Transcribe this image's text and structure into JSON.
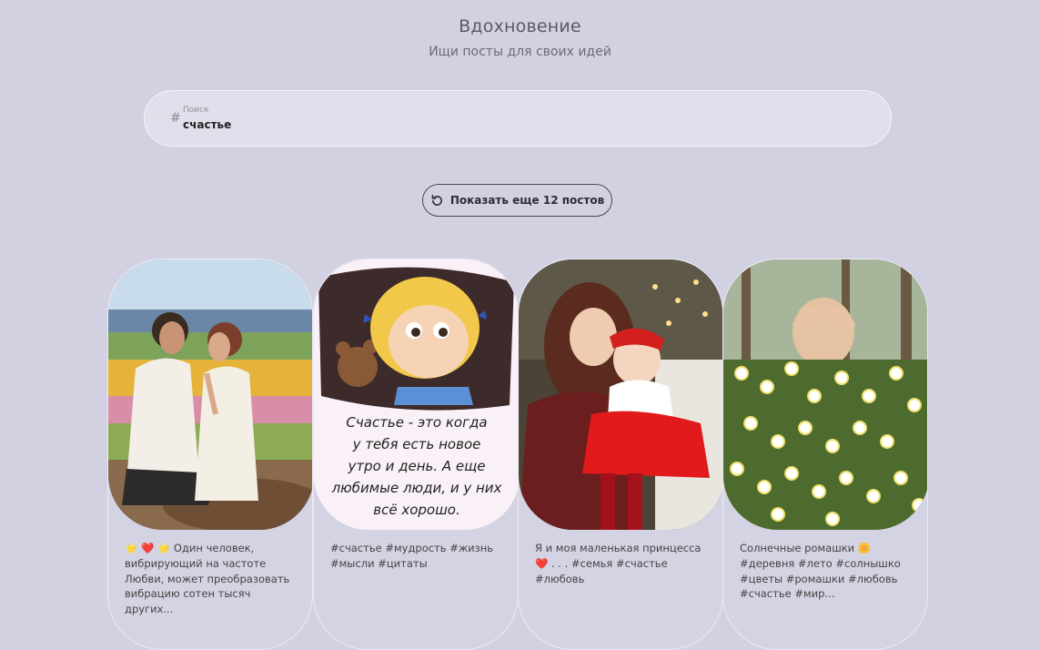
{
  "header": {
    "title": "Вдохновение",
    "subtitle": "Ищи посты для своих идей"
  },
  "search": {
    "label": "Поиск",
    "value": "счастье",
    "prefix": "#"
  },
  "load_more": {
    "label": "Показать еще 12 постов",
    "icon": "refresh-icon"
  },
  "posts": [
    {
      "image": "couple-sitting-on-rock-photo",
      "text": "⭐ ❤️ ⭐ Один человек, вибрирующий на частоте Любви, может преобразовать вибрацию сотен тысяч других..."
    },
    {
      "image": "cartoon-girl-with-quote",
      "image_text": "Счастье - это когда у тебя есть новое утро и день. А еще любимые люди, и у них всё хорошо.",
      "text": "#счастье #мудрость #жизнь #мысли #цитаты"
    },
    {
      "image": "mother-and-baby-photo",
      "text": "Я и моя маленькая принцесса ❤️ . . . #семья #счастье #любовь"
    },
    {
      "image": "woman-behind-daisies-photo",
      "text": "Солнечные ромашки 🌼 #деревня #лето #солнышко #цветы #ромашки #любовь #счастье #мир..."
    }
  ]
}
